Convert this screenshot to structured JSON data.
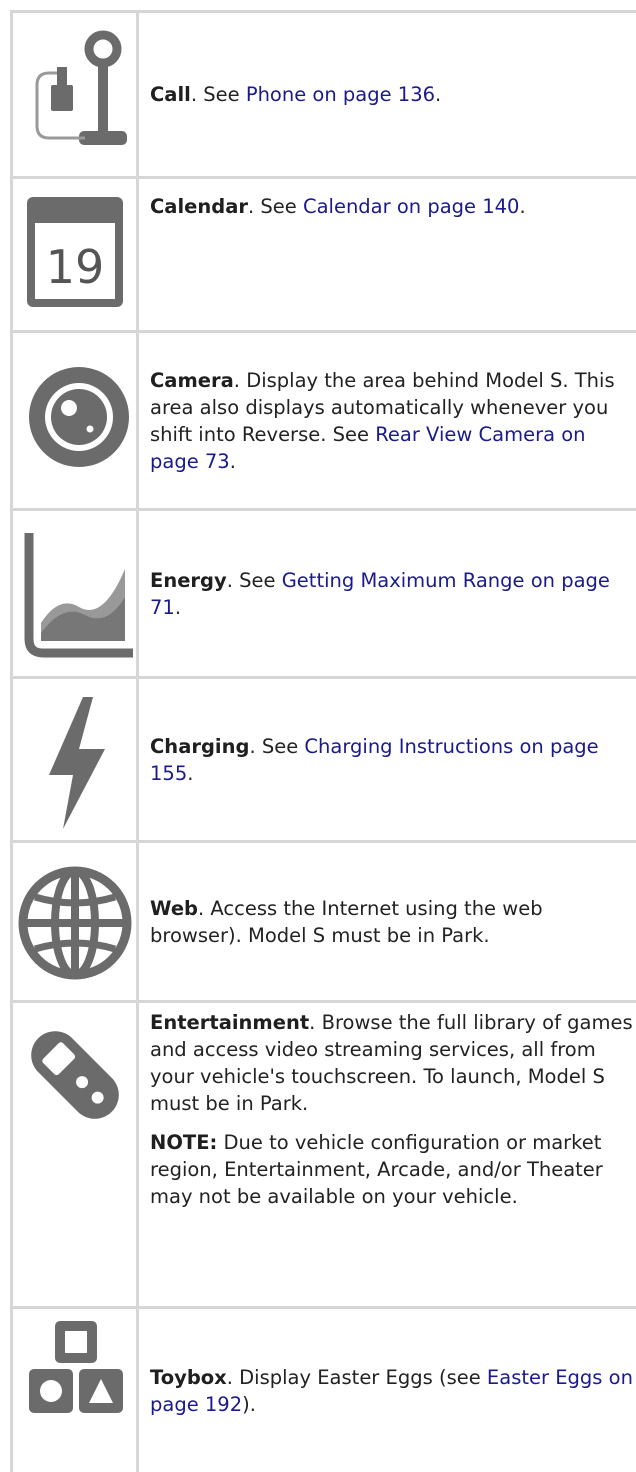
{
  "rows": [
    {
      "icon": "phone-handset-icon",
      "term": "Call",
      "sep": ". See ",
      "link": "Phone on page 136",
      "end": "."
    },
    {
      "icon": "calendar-icon",
      "icon_text": "19",
      "term": "Calendar",
      "sep": ". See ",
      "link": "Calendar on page 140",
      "end": "."
    },
    {
      "icon": "camera-lens-icon",
      "term": "Camera",
      "sep": ". Display the area behind Model S. This area also displays automatically whenever you shift into Reverse. See ",
      "link": "Rear View Camera on page 73",
      "end": "."
    },
    {
      "icon": "energy-graph-icon",
      "term": "Energy",
      "sep": ". See ",
      "link": "Getting Maximum Range on page 71",
      "end": "."
    },
    {
      "icon": "lightning-bolt-icon",
      "term": "Charging",
      "sep": ". See ",
      "link": "Charging Instructions on page 155",
      "end": "."
    },
    {
      "icon": "globe-icon",
      "term": "Web",
      "sep": ". Access the Internet using the web browser). Model S must be in Park."
    },
    {
      "icon": "game-controller-icon",
      "term": "Entertainment",
      "sep": ". Browse the full library of games and access video streaming services, all from your vehicle's touchscreen. To launch, Model S must be in Park.",
      "note_label": "NOTE:",
      "note_text": " Due to vehicle configuration or market region, Entertainment, Arcade, and/or Theater may not be available on your vehicle."
    },
    {
      "icon": "toy-blocks-icon",
      "term": "Toybox",
      "sep": ". Display Easter Eggs (see ",
      "link": "Easter Eggs on page 192",
      "end": ")."
    }
  ]
}
